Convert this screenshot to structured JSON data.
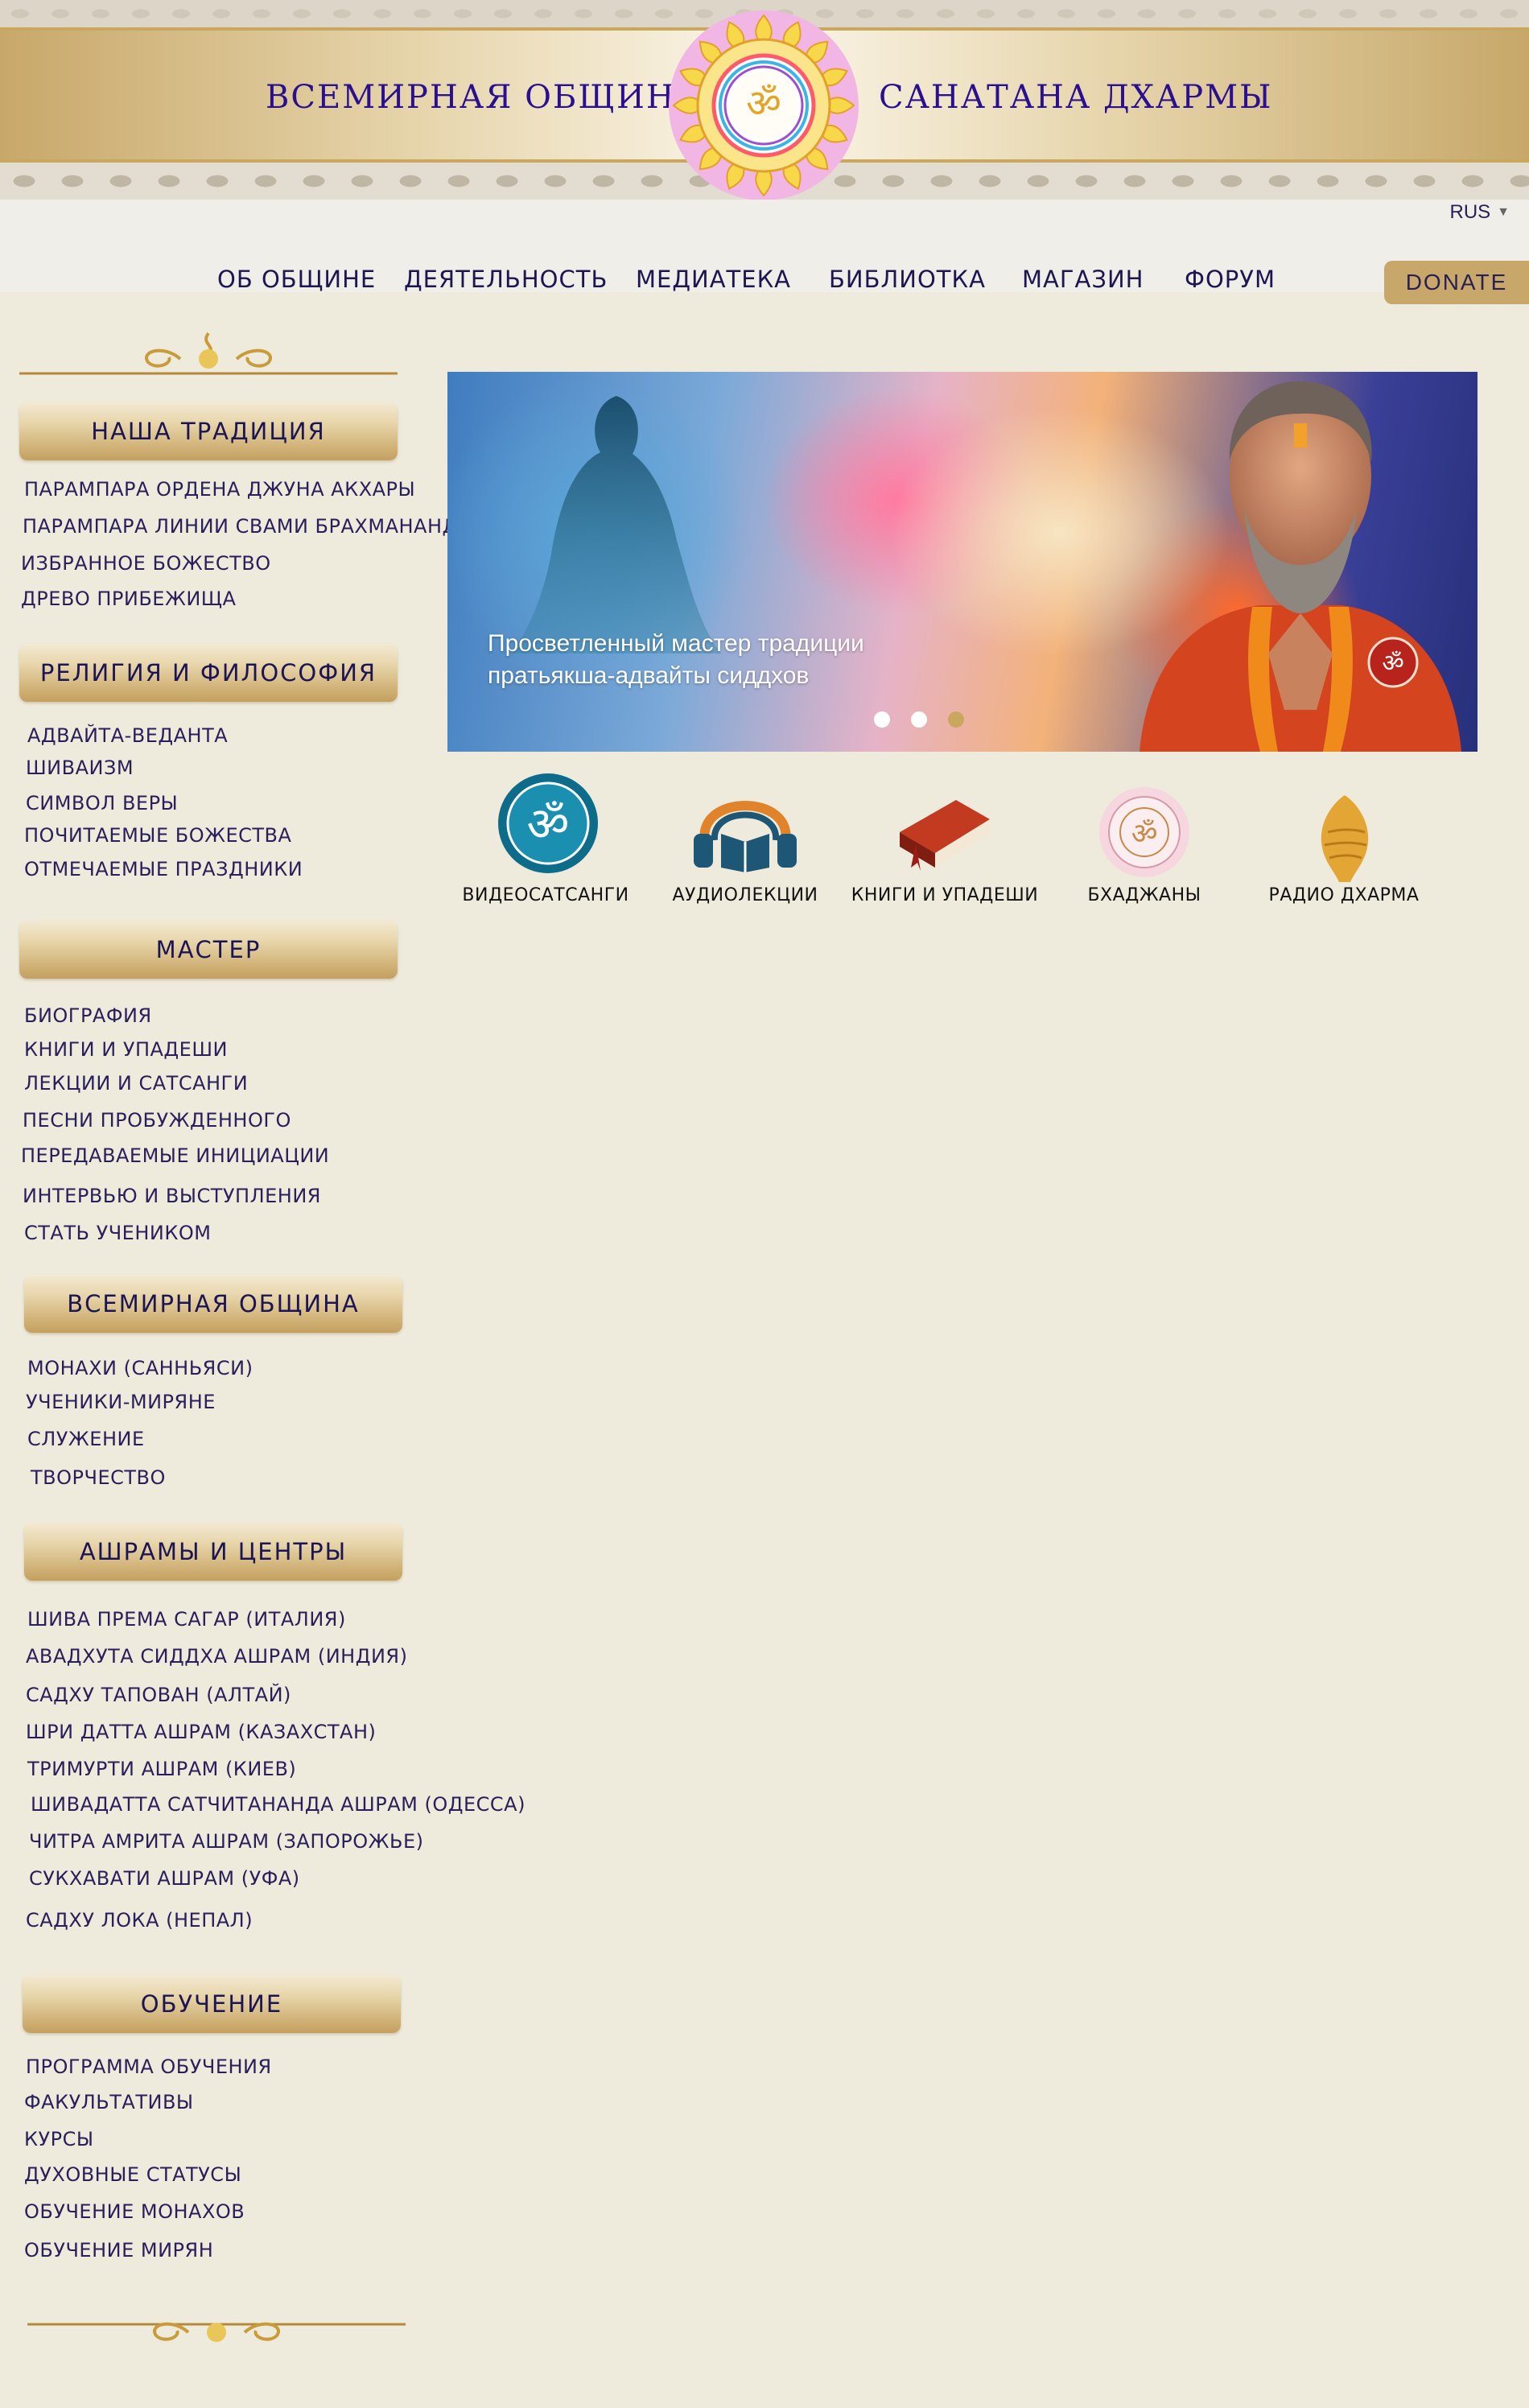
{
  "header": {
    "title_left": "ВСЕМИРНАЯ ОБЩИНА",
    "title_right": "САНАТАНА ДХАРМЫ"
  },
  "lang": {
    "value": "RUS"
  },
  "nav": {
    "items": [
      "ОБ ОБЩИНЕ",
      "ДЕЯТЕЛЬНОСТЬ",
      "МЕДИАТЕКА",
      "БИБЛИОТКА",
      "МАГАЗИН",
      "ФОРУМ"
    ],
    "donate": "DONATE"
  },
  "sidebar": {
    "sections": [
      {
        "title": "НАША ТРАДИЦИЯ",
        "links": [
          "ПАРАМПАРА ОРДЕНА ДЖУНА АКХАРЫ",
          "ПАРАМПАРА ЛИНИИ СВАМИ БРАХМАНАНДЫ",
          "ИЗБРАННОЕ БОЖЕСТВО",
          "ДРЕВО ПРИБЕЖИЩА"
        ]
      },
      {
        "title": "РЕЛИГИЯ И ФИЛОСОФИЯ",
        "links": [
          "АДВАЙТА-ВЕДАНТА",
          "ШИВАИЗМ",
          "СИМВОЛ ВЕРЫ",
          "ПОЧИТАЕМЫЕ БОЖЕСТВА",
          "ОТМЕЧАЕМЫЕ ПРАЗДНИКИ"
        ]
      },
      {
        "title": "МАСТЕР",
        "links": [
          "БИОГРАФИЯ",
          "КНИГИ И УПАДЕШИ",
          "ЛЕКЦИИ И САТСАНГИ",
          "ПЕСНИ ПРОБУЖДЕННОГО",
          "ПЕРЕДАВАЕМЫЕ ИНИЦИАЦИИ",
          "ИНТЕРВЬЮ И ВЫСТУПЛЕНИЯ",
          "СТАТЬ УЧЕНИКОМ"
        ]
      },
      {
        "title": "ВСЕМИРНАЯ ОБЩИНА",
        "links": [
          "МОНАХИ (САННЬЯСИ)",
          "УЧЕНИКИ-МИРЯНЕ",
          "СЛУЖЕНИЕ",
          "ТВОРЧЕСТВО"
        ]
      },
      {
        "title": "АШРАМЫ И ЦЕНТРЫ",
        "links": [
          "ШИВА ПРЕМА САГАР (ИТАЛИЯ)",
          "АВАДХУТА СИДДХА АШРАМ (ИНДИЯ)",
          "САДХУ ТАПОВАН (АЛТАЙ)",
          "ШРИ ДАТТА АШРАМ (КАЗАХСТАН)",
          "ТРИМУРТИ АШРАМ (КИЕВ)",
          "ШИВАДАТТА САТЧИТАНАНДА АШРАМ (ОДЕССА)",
          "ЧИТРА АМРИТА АШРАМ (ЗАПОРОЖЬЕ)",
          "СУКХАВАТИ АШРАМ (УФА)",
          "САДХУ ЛОКА (НЕПАЛ)"
        ]
      },
      {
        "title": "ОБУЧЕНИЕ",
        "links": [
          "ПРОГРАММА ОБУЧЕНИЯ",
          "ФАКУЛЬТАТИВЫ",
          "КУРСЫ",
          "ДУХОВНЫЕ СТАТУСЫ",
          "ОБУЧЕНИЕ МОНАХОВ",
          "ОБУЧЕНИЕ МИРЯН"
        ]
      }
    ]
  },
  "slider": {
    "caption_line1": "Просветленный мастер традиции",
    "caption_line2": "пратьякша-адвайты сиддхов",
    "slide_count": 3,
    "active_slide": 3
  },
  "quick_links": [
    {
      "label": "ВИДЕОСАТСАНГИ",
      "icon": "om-medallion-icon"
    },
    {
      "label": "АУДИОЛЕКЦИИ",
      "icon": "headphones-book-icon"
    },
    {
      "label": "КНИГИ И УПАДЕШИ",
      "icon": "book-icon"
    },
    {
      "label": "БХАДЖАНЫ",
      "icon": "bhajan-disc-icon"
    },
    {
      "label": "РАДИО ДХАРМА",
      "icon": "conch-shell-icon"
    }
  ],
  "colors": {
    "page_bg": "#efebdc",
    "title_blue": "#2a0f8f",
    "nav_text": "#1d1650",
    "gold": "#c8a86a"
  }
}
